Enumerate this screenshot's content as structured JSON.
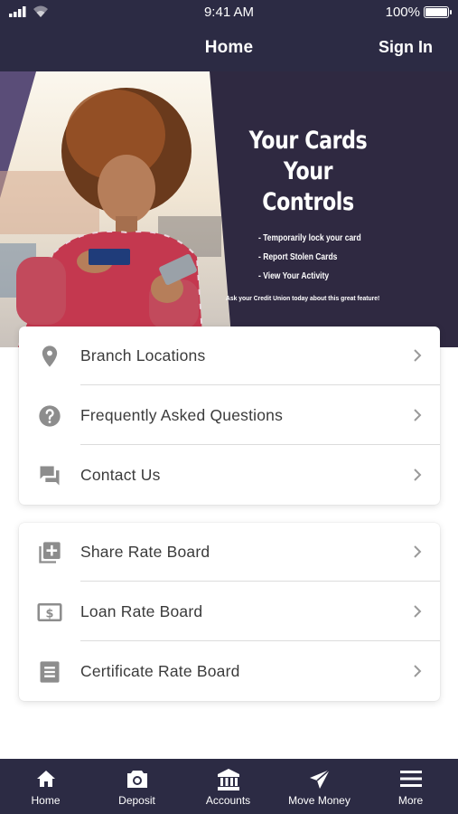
{
  "status_bar": {
    "time": "9:41 AM",
    "battery": "100%"
  },
  "header": {
    "title": "Home",
    "sign_in": "Sign In"
  },
  "banner": {
    "title_line1": "Your Cards",
    "title_line2": "Your Controls",
    "items": [
      "- Temporarily lock your card",
      "- Report Stolen Cards",
      "- View Your Activity"
    ],
    "note": "Ask your Credit Union today about this great feature!"
  },
  "menu_group_1": [
    {
      "label": "Branch Locations",
      "icon": "location-pin-icon"
    },
    {
      "label": "Frequently Asked Questions",
      "icon": "help-circle-icon"
    },
    {
      "label": "Contact Us",
      "icon": "chat-icon"
    }
  ],
  "menu_group_2": [
    {
      "label": "Share Rate Board",
      "icon": "add-box-icon"
    },
    {
      "label": "Loan Rate Board",
      "icon": "dollar-bill-icon"
    },
    {
      "label": "Certificate Rate Board",
      "icon": "document-icon"
    }
  ],
  "bottom_nav": [
    {
      "label": "Home",
      "icon": "home-icon"
    },
    {
      "label": "Deposit",
      "icon": "camera-icon"
    },
    {
      "label": "Accounts",
      "icon": "bank-icon"
    },
    {
      "label": "Move Money",
      "icon": "send-icon"
    },
    {
      "label": "More",
      "icon": "menu-icon"
    }
  ],
  "colors": {
    "brand_navy": "#2c2b44",
    "banner_purple": "#2f2941",
    "icon_gray": "#8d8d8d"
  }
}
